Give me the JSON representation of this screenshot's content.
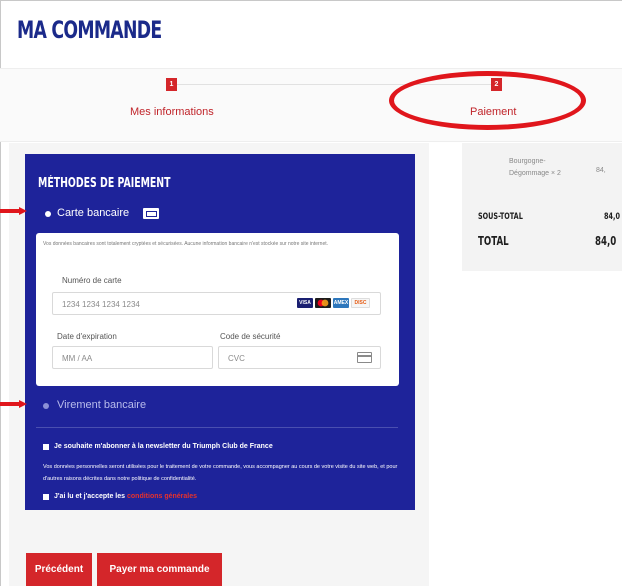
{
  "page": {
    "title": "MA COMMANDE"
  },
  "steps": [
    {
      "number": "1",
      "label": "Mes informations"
    },
    {
      "number": "2",
      "label": "Paiement"
    }
  ],
  "payment": {
    "title": "MÉTHODES DE PAIEMENT",
    "card_method_label": "Carte bancaire",
    "secure_notice": "Vos données bancaires sont totalement cryptées et sécurisées. Aucune information bancaire n'est stockée sur notre site internet.",
    "card_number_label": "Numéro de carte",
    "card_number_placeholder": "1234 1234 1234 1234",
    "expiry_label": "Date d'expiration",
    "expiry_placeholder": "MM / AA",
    "cvc_label": "Code de sécurité",
    "cvc_placeholder": "CVC",
    "card_brands": [
      "VISA",
      "MC",
      "AMEX",
      "DISC"
    ],
    "transfer_method_label": "Virement bancaire"
  },
  "consent": {
    "newsletter_label": "Je souhaite m'abonner à la newsletter du Triumph Club de France",
    "privacy_text": "Vos données personnelles seront utilisées pour le traitement de votre commande, vous accompagner au cours de votre visite du site web, et pour d'autres raisons décrites dans notre politique de confidentialité.",
    "terms_prefix": "J'ai lu et j'accepte les",
    "terms_link": "conditions générales"
  },
  "buttons": {
    "previous": "Précédent",
    "pay": "Payer ma commande"
  },
  "summary": {
    "item_name_line1": "Bourgogne-",
    "item_name_line2": "Dégommage × 2",
    "item_price": "84,",
    "subtotal_label": "SOUS-TOTAL",
    "subtotal_value": "84,0",
    "total_label": "TOTAL",
    "total_value": "84,0"
  },
  "colors": {
    "brand_blue": "#1e239a",
    "accent_red": "#d4262a",
    "annotation_red": "#e0161c"
  }
}
